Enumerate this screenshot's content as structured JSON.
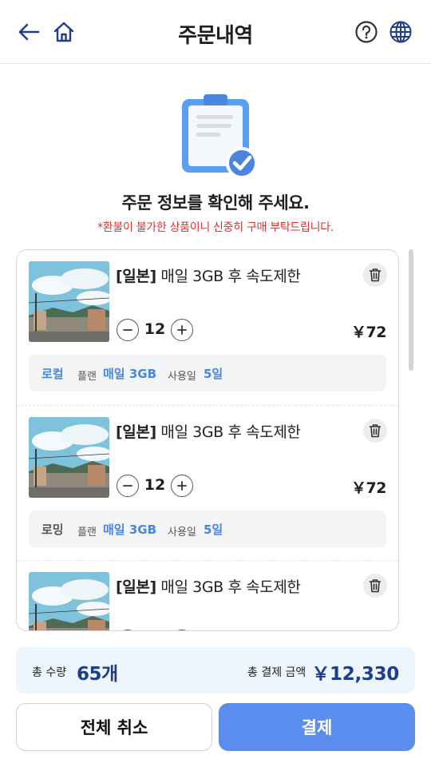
{
  "header": {
    "title": "주문내역",
    "back_icon": "back-arrow-icon",
    "home_icon": "home-icon",
    "help_icon": "help-icon",
    "language_icon": "globe-icon"
  },
  "confirm": {
    "title": "주문 정보를 확인해 주세요.",
    "warning": "*환불이 불가한 상품이니 신중히 구매 부탁드립니다."
  },
  "items": [
    {
      "country": "[일본]",
      "name": "매일 3GB 후 속도제한",
      "quantity": "12",
      "price": "￥72",
      "type": "로컬",
      "plan_label": "플랜",
      "plan_value": "매일 3GB",
      "days_label": "사용일",
      "days_value": "5일"
    },
    {
      "country": "[일본]",
      "name": "매일 3GB 후 속도제한",
      "quantity": "12",
      "price": "￥72",
      "type": "로밍",
      "plan_label": "플랜",
      "plan_value": "매일 3GB",
      "days_label": "사용일",
      "days_value": "5일"
    },
    {
      "country": "[일본]",
      "name": "매일 3GB 후 속도제한"
    }
  ],
  "summary": {
    "qty_label": "총 수량",
    "qty_value": "65개",
    "amount_label": "총 결제 금액",
    "amount_value": "￥12,330"
  },
  "buttons": {
    "cancel_all": "전체 취소",
    "pay": "결제"
  },
  "colors": {
    "accent": "#5b8def",
    "link_blue": "#4a86de",
    "warning_red": "#e0312c",
    "summary_bg": "#edf5fd",
    "total_navy": "#1d3f8a"
  }
}
